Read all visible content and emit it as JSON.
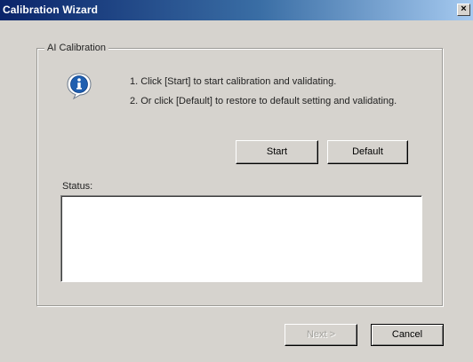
{
  "window": {
    "title": "Calibration Wizard",
    "close_glyph": "×"
  },
  "group": {
    "label": "AI Calibration",
    "icon": "info-icon",
    "instructions": [
      "1. Click [Start] to start calibration and validating.",
      "2. Or click [Default] to restore to default setting and validating."
    ]
  },
  "buttons": {
    "start": "Start",
    "default": "Default",
    "next": "Next >",
    "cancel": "Cancel"
  },
  "status": {
    "label": "Status:",
    "value": ""
  },
  "colors": {
    "titlebar_start": "#0a246a",
    "titlebar_end": "#a6caf0",
    "window_bg": "#d6d3ce",
    "info_icon_blue": "#1f5fb0"
  }
}
